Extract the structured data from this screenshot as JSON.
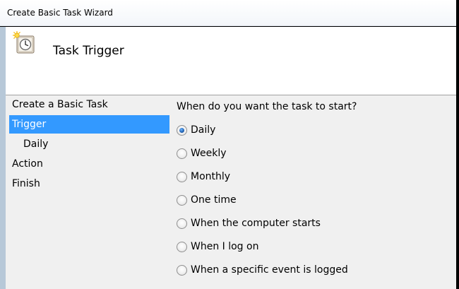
{
  "window": {
    "title": "Create Basic Task Wizard"
  },
  "header": {
    "title": "Task Trigger",
    "icon": "task-clock-icon"
  },
  "nav": {
    "items": [
      {
        "label": "Create a Basic Task",
        "selected": false,
        "sub": false
      },
      {
        "label": "Trigger",
        "selected": true,
        "sub": false
      },
      {
        "label": "Daily",
        "selected": false,
        "sub": true
      },
      {
        "label": "Action",
        "selected": false,
        "sub": false
      },
      {
        "label": "Finish",
        "selected": false,
        "sub": false
      }
    ]
  },
  "content": {
    "question": "When do you want the task to start?",
    "options": [
      {
        "label": "Daily",
        "checked": true
      },
      {
        "label": "Weekly",
        "checked": false
      },
      {
        "label": "Monthly",
        "checked": false
      },
      {
        "label": "One time",
        "checked": false
      },
      {
        "label": "When the computer starts",
        "checked": false
      },
      {
        "label": "When I log on",
        "checked": false
      },
      {
        "label": "When a specific event is logged",
        "checked": false
      }
    ]
  },
  "colors": {
    "selection": "#3399ff",
    "body_bg": "#f0f0f0",
    "header_bg": "#ffffff"
  }
}
